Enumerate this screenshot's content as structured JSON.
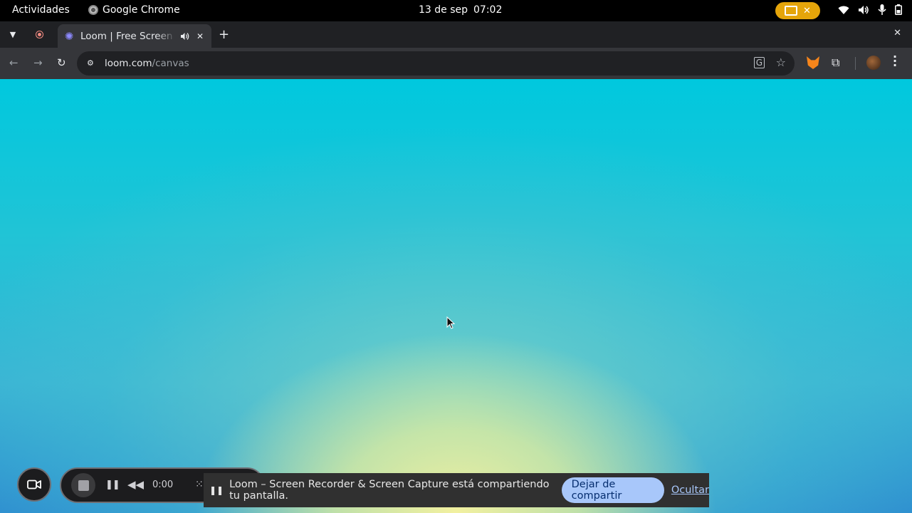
{
  "system_bar": {
    "activities": "Actividades",
    "app_name": "Google Chrome",
    "date": "13 de sep",
    "time": "07:02",
    "share_indicator": {
      "icon": "screen-share-icon",
      "color": "#e5a50a"
    },
    "status_icons": [
      "wifi-icon",
      "volume-icon",
      "microphone-icon",
      "battery-icon"
    ]
  },
  "browser": {
    "tabs": [
      {
        "title": "Loom | Free Screen & Video Recording Software",
        "favicon": "loom-icon",
        "audio": true,
        "active": true
      }
    ],
    "address_bar": {
      "domain": "loom.com",
      "path": "/canvas"
    },
    "toolbar_icons": [
      "back-icon",
      "forward-icon",
      "reload-icon",
      "site-info-icon",
      "translate-icon",
      "bookmark-star-icon",
      "metamask-icon",
      "extensions-icon",
      "profile-avatar",
      "menu-icon"
    ]
  },
  "loom_controls": {
    "timer": "0:00",
    "buttons": [
      "camera-icon",
      "stop-button",
      "pause-button",
      "rewind-button",
      "drawing-tools-button"
    ]
  },
  "share_banner": {
    "message": "Loom – Screen Recorder & Screen Capture está compartiendo tu pantalla.",
    "stop_button": "Dejar de compartir",
    "hide_link": "Ocultar",
    "accent_color": "#a8c7fa"
  }
}
